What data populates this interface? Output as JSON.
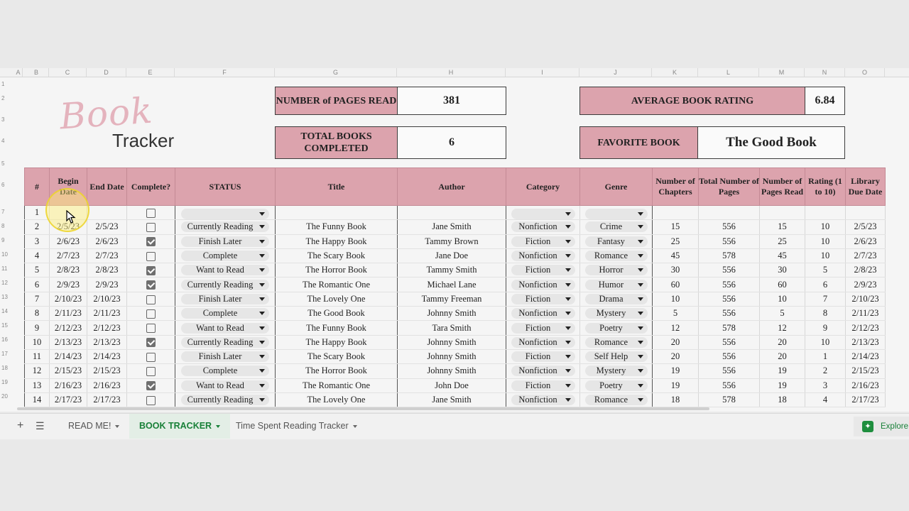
{
  "logo": {
    "script": "Book",
    "sans": "Tracker"
  },
  "summary": {
    "pages_label": "NUMBER of PAGES READ",
    "pages_value": "381",
    "books_label": "TOTAL BOOKS COMPLETED",
    "books_value": "6",
    "rating_label": "AVERAGE BOOK RATING",
    "rating_value": "6.84",
    "favorite_label": "FAVORITE BOOK",
    "favorite_value": "The Good Book"
  },
  "column_letters": [
    "A",
    "B",
    "C",
    "D",
    "E",
    "F",
    "G",
    "H",
    "I",
    "J",
    "K",
    "L",
    "M",
    "N",
    "O"
  ],
  "row_numbers": [
    "1",
    "2",
    "3",
    "4",
    "5",
    "6",
    "7",
    "8",
    "9",
    "10",
    "11",
    "12",
    "13",
    "14",
    "15",
    "16",
    "17",
    "18",
    "19",
    "20"
  ],
  "table": {
    "headers": [
      "#",
      "Begin Date",
      "End Date",
      "Complete?",
      "STATUS",
      "Title",
      "Author",
      "Category",
      "Genre",
      "Number of Chapters",
      "Total Number of Pages",
      "Number of Pages Read",
      "Rating (1 to 10)",
      "Library Due Date"
    ],
    "rows": [
      {
        "n": "1",
        "begin": "",
        "end": "",
        "done": false,
        "status": "",
        "title": "",
        "author": "",
        "category": "",
        "genre": "",
        "chapters": "",
        "total": "",
        "read": "",
        "rating": "",
        "due": ""
      },
      {
        "n": "2",
        "begin": "2/5/23",
        "end": "2/5/23",
        "done": false,
        "status": "Currently Reading",
        "title": "The Funny Book",
        "author": "Jane Smith",
        "category": "Nonfiction",
        "genre": "Crime",
        "chapters": "15",
        "total": "556",
        "read": "15",
        "rating": "10",
        "due": "2/5/23"
      },
      {
        "n": "3",
        "begin": "2/6/23",
        "end": "2/6/23",
        "done": true,
        "status": "Finish Later",
        "title": "The Happy Book",
        "author": "Tammy Brown",
        "category": "Fiction",
        "genre": "Fantasy",
        "chapters": "25",
        "total": "556",
        "read": "25",
        "rating": "10",
        "due": "2/6/23"
      },
      {
        "n": "4",
        "begin": "2/7/23",
        "end": "2/7/23",
        "done": false,
        "status": "Complete",
        "title": "The Scary Book",
        "author": "Jane Doe",
        "category": "Nonfiction",
        "genre": "Romance",
        "chapters": "45",
        "total": "578",
        "read": "45",
        "rating": "10",
        "due": "2/7/23"
      },
      {
        "n": "5",
        "begin": "2/8/23",
        "end": "2/8/23",
        "done": true,
        "status": "Want to Read",
        "title": "The Horror Book",
        "author": "Tammy Smith",
        "category": "Fiction",
        "genre": "Horror",
        "chapters": "30",
        "total": "556",
        "read": "30",
        "rating": "5",
        "due": "2/8/23"
      },
      {
        "n": "6",
        "begin": "2/9/23",
        "end": "2/9/23",
        "done": true,
        "status": "Currently Reading",
        "title": "The Romantic One",
        "author": "Michael Lane",
        "category": "Nonfiction",
        "genre": "Humor",
        "chapters": "60",
        "total": "556",
        "read": "60",
        "rating": "6",
        "due": "2/9/23"
      },
      {
        "n": "7",
        "begin": "2/10/23",
        "end": "2/10/23",
        "done": false,
        "status": "Finish Later",
        "title": "The Lovely One",
        "author": "Tammy Freeman",
        "category": "Fiction",
        "genre": "Drama",
        "chapters": "10",
        "total": "556",
        "read": "10",
        "rating": "7",
        "due": "2/10/23"
      },
      {
        "n": "8",
        "begin": "2/11/23",
        "end": "2/11/23",
        "done": false,
        "status": "Complete",
        "title": "The Good Book",
        "author": "Johnny Smith",
        "category": "Nonfiction",
        "genre": "Mystery",
        "chapters": "5",
        "total": "556",
        "read": "5",
        "rating": "8",
        "due": "2/11/23"
      },
      {
        "n": "9",
        "begin": "2/12/23",
        "end": "2/12/23",
        "done": false,
        "status": "Want to Read",
        "title": "The Funny Book",
        "author": "Tara Smith",
        "category": "Fiction",
        "genre": "Poetry",
        "chapters": "12",
        "total": "578",
        "read": "12",
        "rating": "9",
        "due": "2/12/23"
      },
      {
        "n": "10",
        "begin": "2/13/23",
        "end": "2/13/23",
        "done": true,
        "status": "Currently Reading",
        "title": "The Happy Book",
        "author": "Johnny Smith",
        "category": "Nonfiction",
        "genre": "Romance",
        "chapters": "20",
        "total": "556",
        "read": "20",
        "rating": "10",
        "due": "2/13/23"
      },
      {
        "n": "11",
        "begin": "2/14/23",
        "end": "2/14/23",
        "done": false,
        "status": "Finish Later",
        "title": "The Scary Book",
        "author": "Johnny Smith",
        "category": "Fiction",
        "genre": "Self Help",
        "chapters": "20",
        "total": "556",
        "read": "20",
        "rating": "1",
        "due": "2/14/23"
      },
      {
        "n": "12",
        "begin": "2/15/23",
        "end": "2/15/23",
        "done": false,
        "status": "Complete",
        "title": "The Horror Book",
        "author": "Johnny Smith",
        "category": "Nonfiction",
        "genre": "Mystery",
        "chapters": "19",
        "total": "556",
        "read": "19",
        "rating": "2",
        "due": "2/15/23"
      },
      {
        "n": "13",
        "begin": "2/16/23",
        "end": "2/16/23",
        "done": true,
        "status": "Want to Read",
        "title": "The Romantic One",
        "author": "John Doe",
        "category": "Fiction",
        "genre": "Poetry",
        "chapters": "19",
        "total": "556",
        "read": "19",
        "rating": "3",
        "due": "2/16/23"
      },
      {
        "n": "14",
        "begin": "2/17/23",
        "end": "2/17/23",
        "done": false,
        "status": "Currently Reading",
        "title": "The Lovely One",
        "author": "Jane Smith",
        "category": "Nonfiction",
        "genre": "Romance",
        "chapters": "18",
        "total": "578",
        "read": "18",
        "rating": "4",
        "due": "2/17/23"
      }
    ]
  },
  "tabs": [
    {
      "label": "READ ME!",
      "active": false
    },
    {
      "label": "BOOK TRACKER",
      "active": true
    },
    {
      "label": "Time Spent Reading Tracker",
      "active": false
    }
  ],
  "explore_label": "Explore",
  "icons": {
    "add": "plus-icon",
    "list": "all-sheets-icon",
    "explore": "explore-icon"
  },
  "colors": {
    "header_pink": "#dca3ad",
    "active_tab": "#188038"
  }
}
